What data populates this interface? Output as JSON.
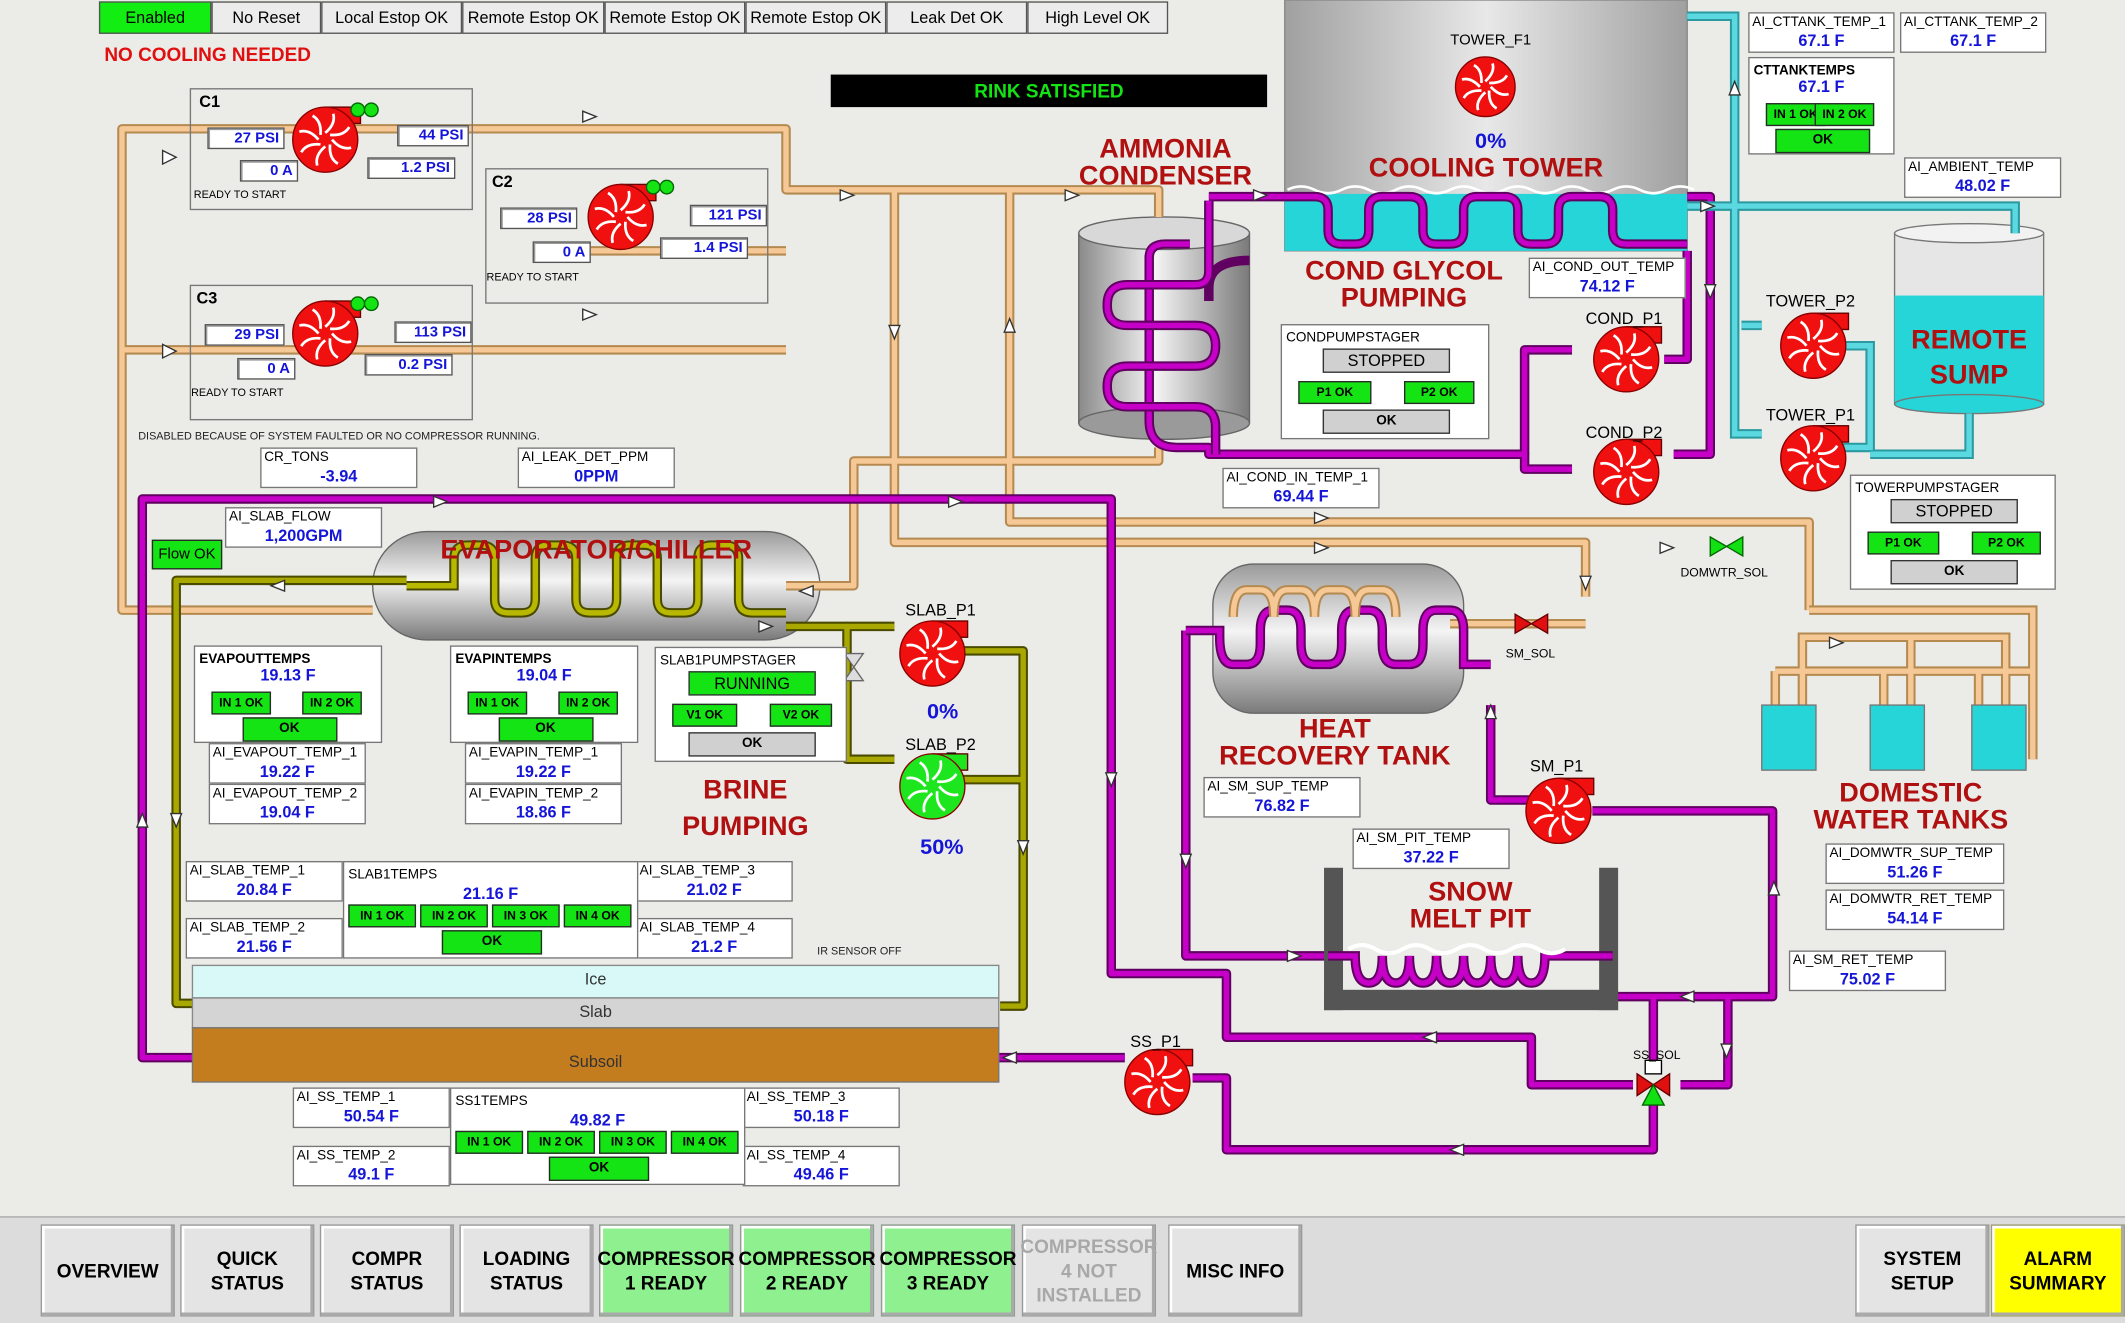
{
  "status_bar": [
    {
      "label": "Enabled",
      "active": true
    },
    {
      "label": "No Reset",
      "active": false
    },
    {
      "label": "Local Estop OK",
      "active": false
    },
    {
      "label": "Remote Estop OK",
      "active": false
    },
    {
      "label": "Remote Estop OK",
      "active": false
    },
    {
      "label": "Remote Estop OK",
      "active": false
    },
    {
      "label": "Leak Det OK",
      "active": false
    },
    {
      "label": "High Level OK",
      "active": false
    }
  ],
  "alerts": {
    "cooling": "NO COOLING NEEDED",
    "rink": "RINK SATISFIED",
    "disabled_note": "DISABLED BECAUSE OF SYSTEM FAULTED OR NO COMPRESSOR RUNNING.",
    "ir_sensor": "IR SENSOR OFF"
  },
  "compressors": [
    {
      "name": "C1",
      "suction": "27 PSI",
      "discharge": "44 PSI",
      "amps": "0 A",
      "oil": "1.2 PSI",
      "state": "READY TO START"
    },
    {
      "name": "C2",
      "suction": "28 PSI",
      "discharge": "121 PSI",
      "amps": "0 A",
      "oil": "1.4 PSI",
      "state": "READY TO START"
    },
    {
      "name": "C3",
      "suction": "29 PSI",
      "discharge": "113 PSI",
      "amps": "0 A",
      "oil": "0.2 PSI",
      "state": "READY TO START"
    }
  ],
  "equipment": {
    "condenser": "AMMONIA\nCONDENSER",
    "cooling_tower": "COOLING TOWER",
    "tower_fan": "TOWER_F1",
    "tower_fan_pct": "0%",
    "cond_glycol": "COND GLYCOL\nPUMPING",
    "evaporator": "EVAPORATOR/CHILLER",
    "brine": "BRINE\nPUMPING",
    "heat_recovery": "HEAT\nRECOVERY TANK",
    "snow_melt": "SNOW\nMELT PIT",
    "remote_sump": "REMOTE\nSUMP",
    "domestic": "DOMESTIC\nWATER TANKS",
    "slab_p1": "SLAB_P1",
    "slab_p1_pct": "0%",
    "slab_p2": "SLAB_P2",
    "slab_p2_pct": "50%",
    "cond_p1": "COND_P1",
    "cond_p2": "COND_P2",
    "tower_p1": "TOWER_P1",
    "tower_p2": "TOWER_P2",
    "sm_p1": "SM_P1",
    "ss_p1": "SS_P1",
    "sm_sol": "SM_SOL",
    "ss_sol": "SS_SOL",
    "domwtr_sol": "DOMWTR_SOL",
    "flow_ok": "Flow OK",
    "ice": "Ice",
    "slab": "Slab",
    "subsoil": "Subsoil"
  },
  "readouts": {
    "cr_tons": {
      "tag": "CR_TONS",
      "value": "-3.94"
    },
    "leak": {
      "tag": "AI_LEAK_DET_PPM",
      "value": "0PPM"
    },
    "slab_flow": {
      "tag": "AI_SLAB_FLOW",
      "value": "1,200GPM"
    },
    "cttank1": {
      "tag": "AI_CTTANK_TEMP_1",
      "value": "67.1 F"
    },
    "cttank2": {
      "tag": "AI_CTTANK_TEMP_2",
      "value": "67.1 F"
    },
    "ambient": {
      "tag": "AI_AMBIENT_TEMP",
      "value": "48.02 F"
    },
    "cond_out": {
      "tag": "AI_COND_OUT_TEMP",
      "value": "74.12 F"
    },
    "cond_in": {
      "tag": "AI_COND_IN_TEMP_1",
      "value": "69.44 F"
    },
    "evapout1": {
      "tag": "AI_EVAPOUT_TEMP_1",
      "value": "19.22 F"
    },
    "evapout2": {
      "tag": "AI_EVAPOUT_TEMP_2",
      "value": "19.04 F"
    },
    "evapin1": {
      "tag": "AI_EVAPIN_TEMP_1",
      "value": "19.22 F"
    },
    "evapin2": {
      "tag": "AI_EVAPIN_TEMP_2",
      "value": "18.86 F"
    },
    "slab1": {
      "tag": "AI_SLAB_TEMP_1",
      "value": "20.84 F"
    },
    "slab2": {
      "tag": "AI_SLAB_TEMP_2",
      "value": "21.56 F"
    },
    "slab3": {
      "tag": "AI_SLAB_TEMP_3",
      "value": "21.02 F"
    },
    "slab4": {
      "tag": "AI_SLAB_TEMP_4",
      "value": "21.2 F"
    },
    "sm_sup": {
      "tag": "AI_SM_SUP_TEMP",
      "value": "76.82 F"
    },
    "sm_pit": {
      "tag": "AI_SM_PIT_TEMP",
      "value": "37.22 F"
    },
    "sm_ret": {
      "tag": "AI_SM_RET_TEMP",
      "value": "75.02 F"
    },
    "dom_sup": {
      "tag": "AI_DOMWTR_SUP_TEMP",
      "value": "51.26 F"
    },
    "dom_ret": {
      "tag": "AI_DOMWTR_RET_TEMP",
      "value": "54.14 F"
    },
    "ss1": {
      "tag": "AI_SS_TEMP_1",
      "value": "50.54 F"
    },
    "ss2": {
      "tag": "AI_SS_TEMP_2",
      "value": "49.1 F"
    },
    "ss3": {
      "tag": "AI_SS_TEMP_3",
      "value": "50.18 F"
    },
    "ss4": {
      "tag": "AI_SS_TEMP_4",
      "value": "49.46 F"
    }
  },
  "panels": {
    "cttank": {
      "title": "CTTANKTEMPS",
      "value": "67.1 F",
      "b1": "IN 1 OK",
      "b2": "IN 2 OK",
      "ok": "OK"
    },
    "condpump": {
      "title": "CONDPUMPSTAGER",
      "state": "STOPPED",
      "b1": "P1 OK",
      "b2": "P2 OK",
      "ok": "OK"
    },
    "towerpump": {
      "title": "TOWERPUMPSTAGER",
      "state": "STOPPED",
      "b1": "P1 OK",
      "b2": "P2 OK",
      "ok": "OK"
    },
    "evapout": {
      "title": "EVAPOUTTEMPS",
      "value": "19.13 F",
      "b1": "IN 1 OK",
      "b2": "IN 2 OK",
      "ok": "OK"
    },
    "evapin": {
      "title": "EVAPINTEMPS",
      "value": "19.04 F",
      "b1": "IN 1 OK",
      "b2": "IN 2 OK",
      "ok": "OK"
    },
    "slab1pump": {
      "title": "SLAB1PUMPSTAGER",
      "state": "RUNNING",
      "b1": "V1 OK",
      "b2": "V2 OK",
      "ok": "OK"
    },
    "slab1temps": {
      "title": "SLAB1TEMPS",
      "value": "21.16 F",
      "b1": "IN 1 OK",
      "b2": "IN 2 OK",
      "b3": "IN 3 OK",
      "b4": "IN 4 OK",
      "ok": "OK"
    },
    "ss1temps": {
      "title": "SS1TEMPS",
      "value": "49.82 F",
      "b1": "IN 1 OK",
      "b2": "IN 2 OK",
      "b3": "IN 3 OK",
      "b4": "IN 4 OK",
      "ok": "OK"
    }
  },
  "nav": {
    "overview": "OVERVIEW",
    "quick": "QUICK\nSTATUS",
    "compr": "COMPR\nSTATUS",
    "loading": "LOADING\nSTATUS",
    "comp1": "COMPRESSOR\n1 READY",
    "comp2": "COMPRESSOR\n2 READY",
    "comp3": "COMPRESSOR\n3 READY",
    "comp4": "COMPRESSOR\n4 NOT\nINSTALLED",
    "misc": "MISC INFO",
    "system": "SYSTEM\nSETUP",
    "alarm": "ALARM\nSUMMARY"
  },
  "colors": {
    "pipe_glycol": "#c600c6",
    "pipe_ammonia": "#f5c896",
    "pipe_brine": "#7a7a00",
    "pipe_water": "#5cd8e0",
    "title_red": "#b01010",
    "readout_blue": "#1515d8",
    "ok_green": "#14e314"
  }
}
